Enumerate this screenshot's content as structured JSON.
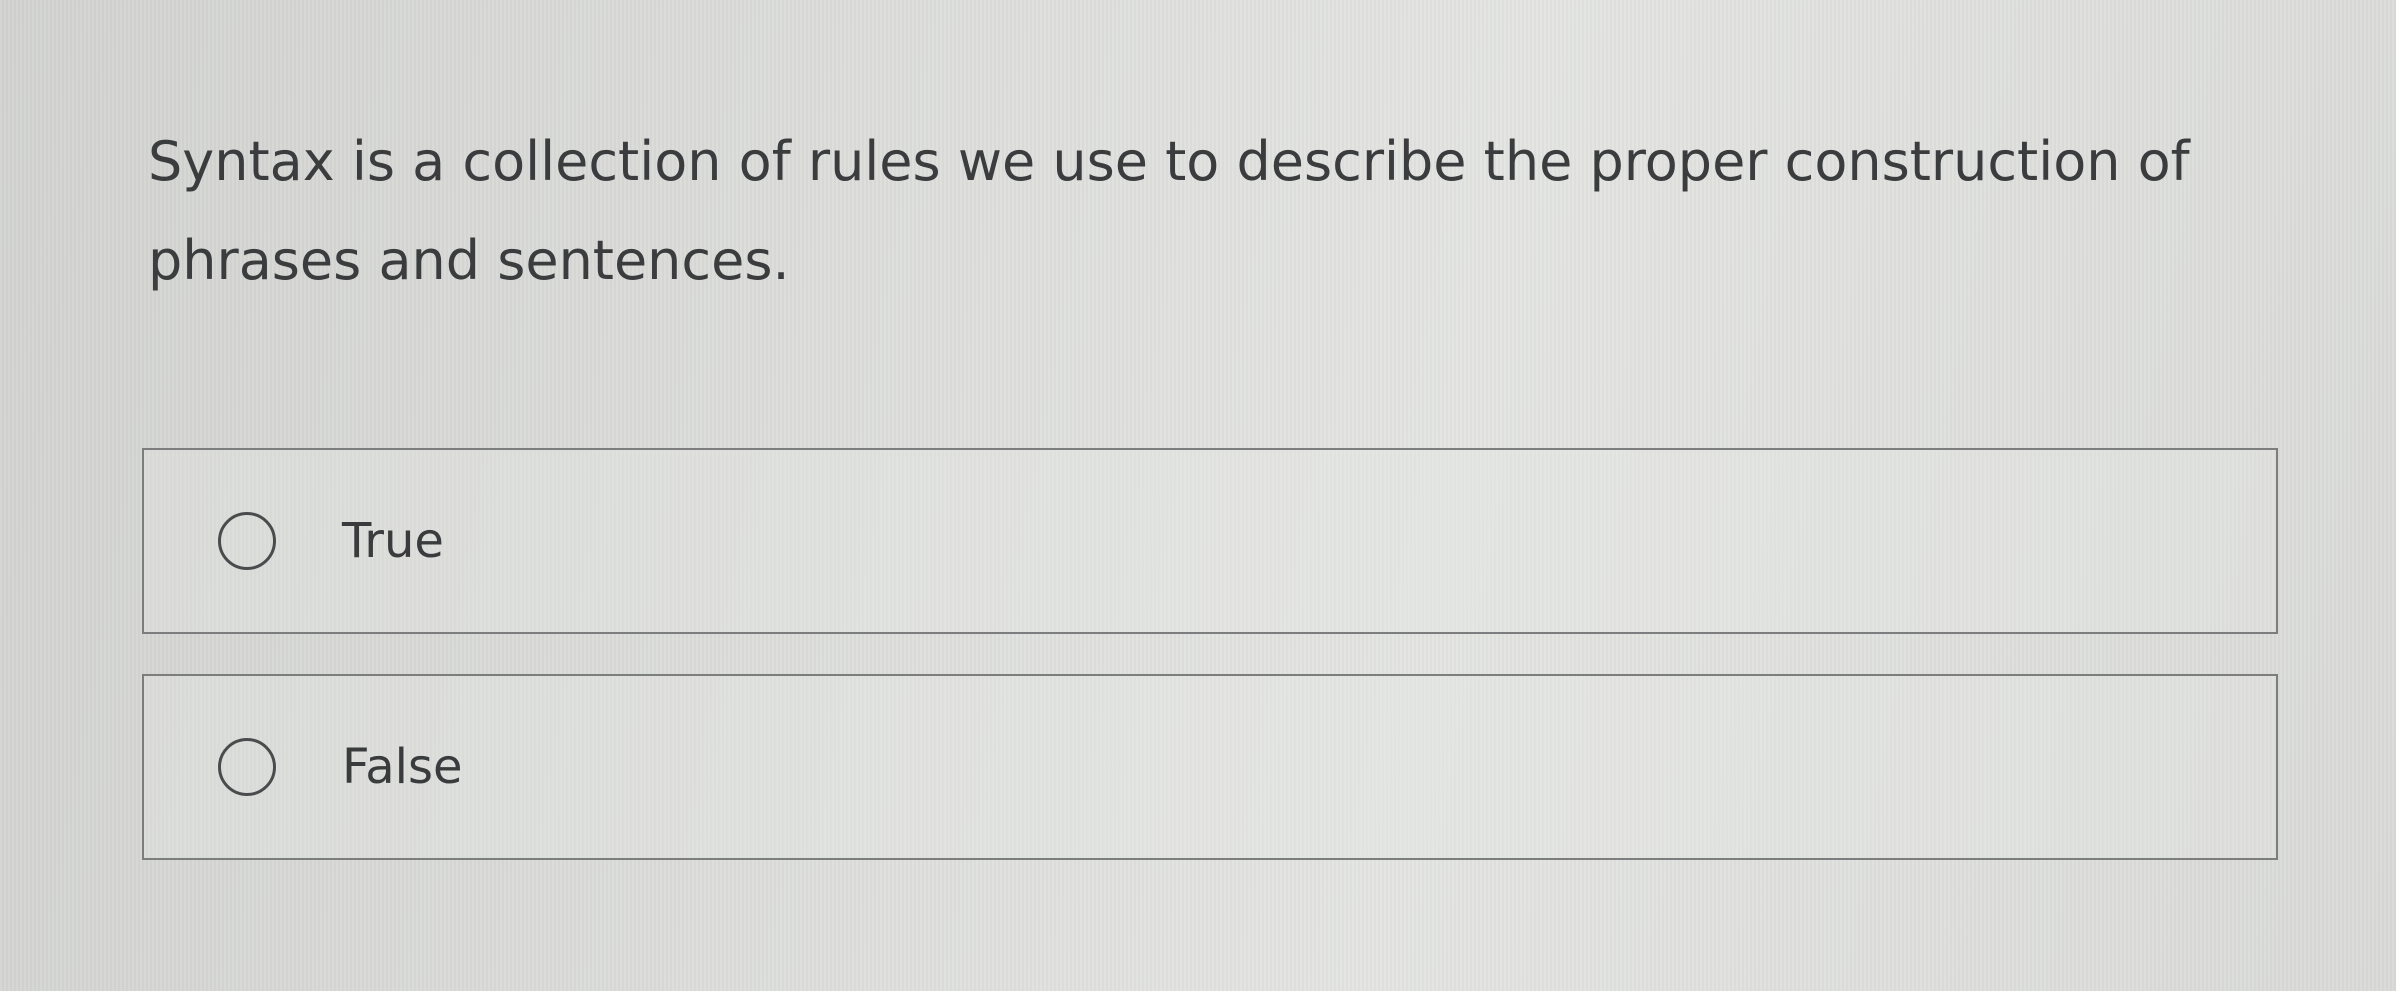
{
  "question": {
    "text": "Syntax is a collection of rules we use to describe the proper construction of phrases and sentences."
  },
  "options": [
    {
      "label": "True",
      "selected": false
    },
    {
      "label": "False",
      "selected": false
    }
  ]
}
